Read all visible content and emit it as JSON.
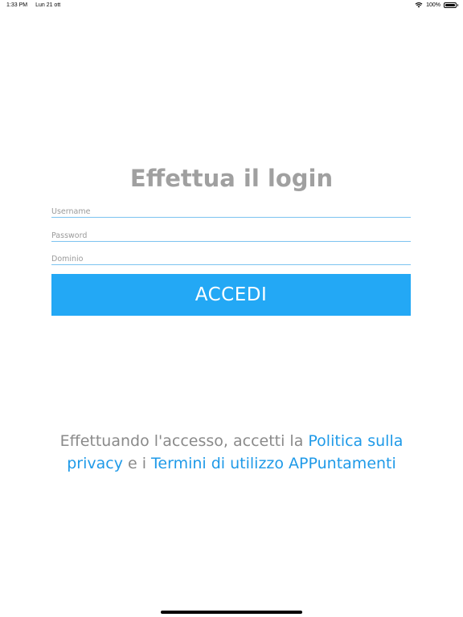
{
  "status_bar": {
    "time": "1:33 PM",
    "date": "Lun 21 ott",
    "battery": "100%",
    "battery_level": 1.0
  },
  "login": {
    "title": "Effettua il login",
    "username_placeholder": "Username",
    "password_placeholder": "Password",
    "domain_placeholder": "Dominio",
    "username_value": "",
    "password_value": "",
    "domain_value": "",
    "submit_label": "ACCEDI"
  },
  "legal": {
    "text_before": "Effettuando l'accesso, accetti la ",
    "privacy_link": "Politica sulla privacy",
    "text_middle": " e i ",
    "terms_link": "Termini di utilizzo APPuntamenti"
  },
  "colors": {
    "accent": "#23a8f5",
    "link": "#1f9ae8",
    "title": "#a0a0a0",
    "underline": "#7cc3f0"
  },
  "icons": {
    "wifi": "wifi-icon",
    "battery": "battery-icon"
  }
}
